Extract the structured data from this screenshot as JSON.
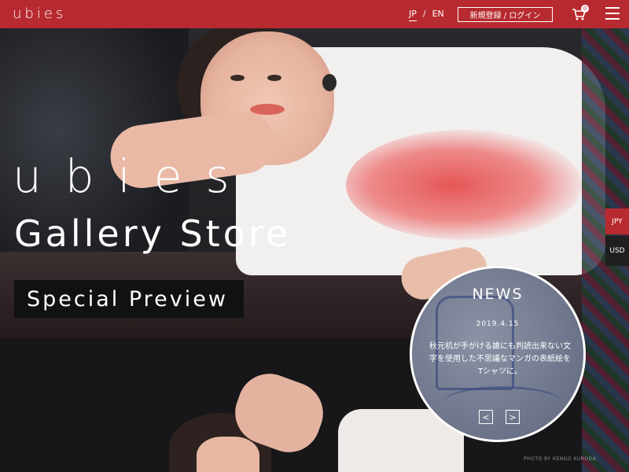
{
  "header": {
    "logo": "ubies",
    "lang": {
      "jp": "JP",
      "sep": "/",
      "en": "EN"
    },
    "login_label": "新規登録 / ログイン",
    "cart_count": "0"
  },
  "hero": {
    "title": "ubies",
    "subtitle": "Gallery Store",
    "preview_label": "Special Preview"
  },
  "currency": {
    "jpy": "JPY",
    "usd": "USD"
  },
  "news": {
    "title": "NEWS",
    "date": "2019.4.15",
    "body": "秋元机が手がける誰にも判読出来ない文字を使用した不思議なマンガの表紙絵をTシャツに。",
    "prev": "<",
    "next": ">"
  },
  "photo_credit": "PHOTO BY KENGO KURODA"
}
